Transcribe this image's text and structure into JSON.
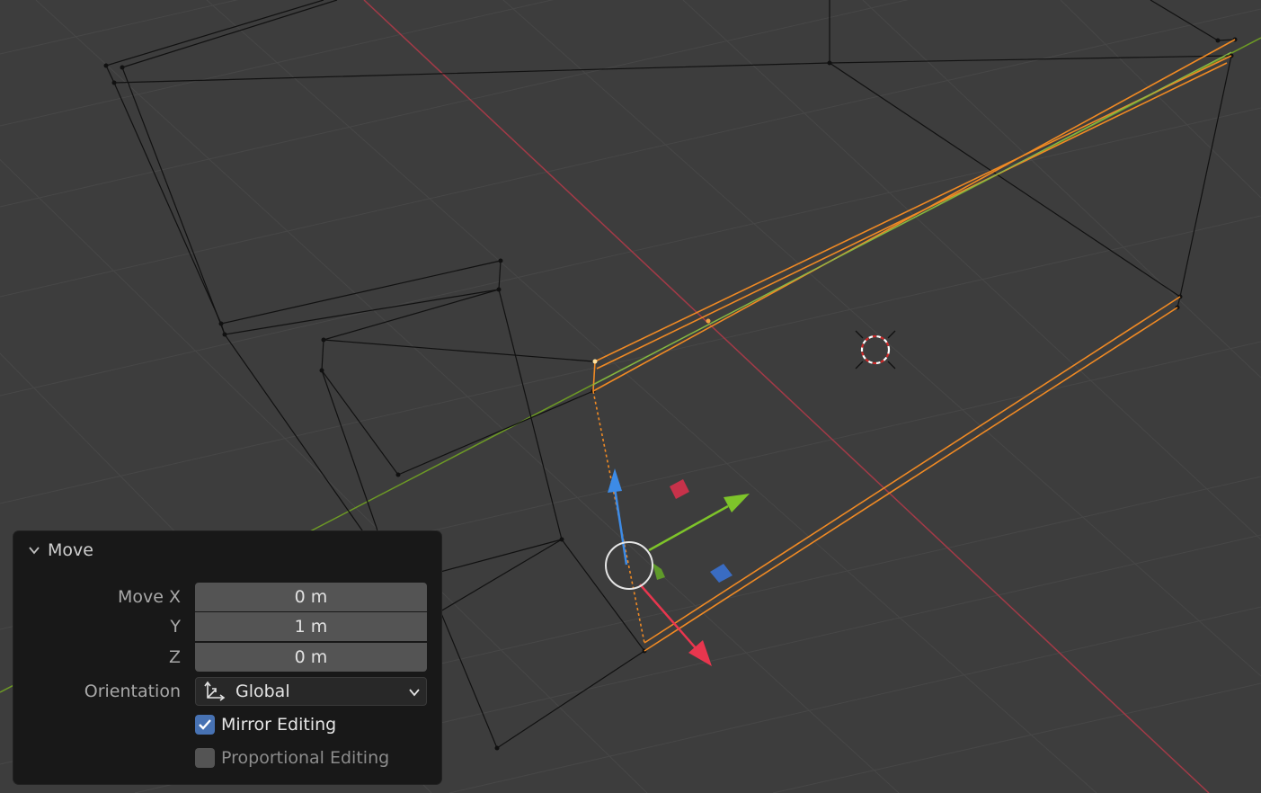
{
  "operator_panel": {
    "title": "Move",
    "move_label": "Move X",
    "move_x": "0 m",
    "y_label": "Y",
    "move_y": "1 m",
    "z_label": "Z",
    "move_z": "0 m",
    "orientation_label": "Orientation",
    "orientation_value": "Global",
    "mirror_editing_label": "Mirror Editing",
    "mirror_editing_checked": true,
    "proportional_editing_label": "Proportional Editing",
    "proportional_editing_checked": false
  },
  "gizmo_colors": {
    "x_axis": "#e8364e",
    "y_axis": "#7ec42a",
    "z_axis": "#3d8be6",
    "selection": "#f08a24"
  }
}
